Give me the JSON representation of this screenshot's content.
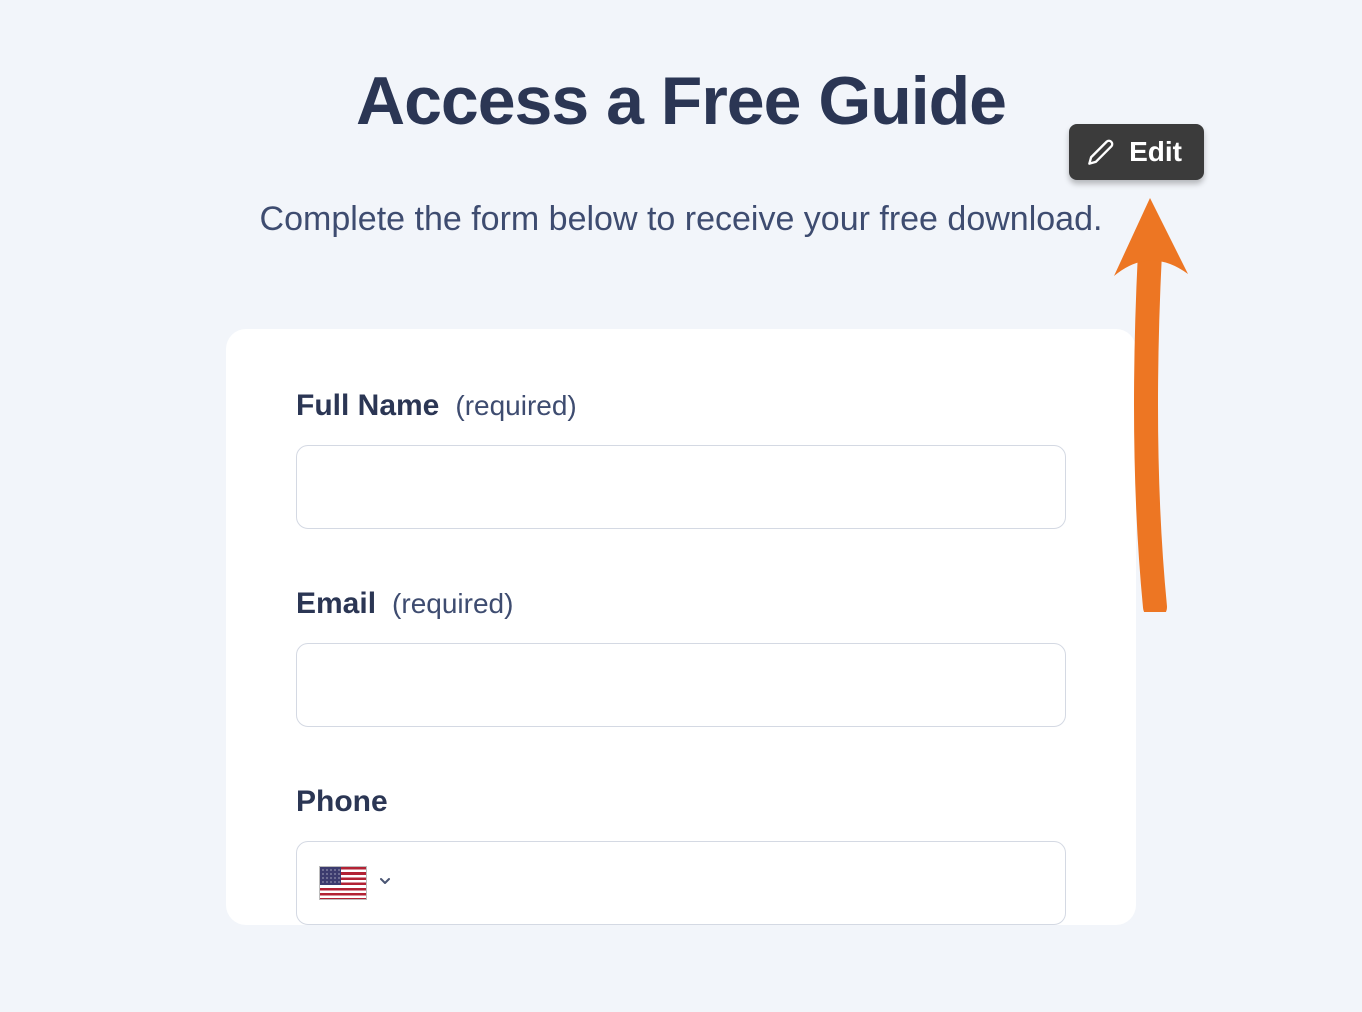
{
  "header": {
    "title": "Access a Free Guide",
    "subtitle": "Complete the form below to receive your free download."
  },
  "edit_button": {
    "label": "Edit"
  },
  "form": {
    "full_name": {
      "label": "Full Name",
      "required_text": "(required)",
      "value": ""
    },
    "email": {
      "label": "Email",
      "required_text": "(required)",
      "value": ""
    },
    "phone": {
      "label": "Phone",
      "country_flag": "us",
      "value": ""
    }
  }
}
